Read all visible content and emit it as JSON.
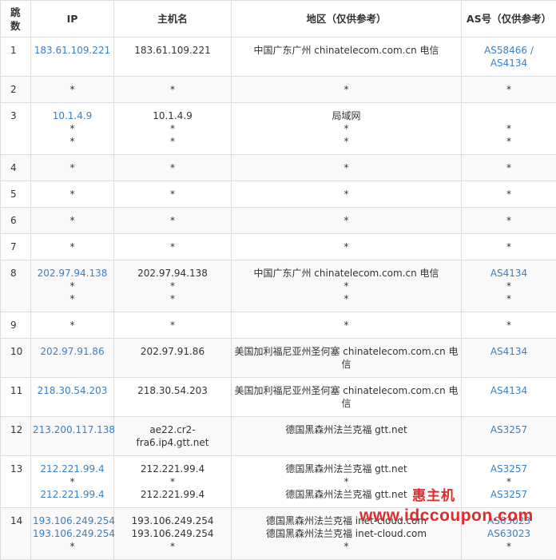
{
  "headers": {
    "hop": "跳\n数",
    "ip": "IP",
    "host": "主机名",
    "region": "地区（仅供参考）",
    "as": "AS号（仅供参考）"
  },
  "rows": [
    {
      "hop": "1",
      "ip": [
        {
          "t": "183.61.109.221",
          "link": true
        }
      ],
      "host": [
        "183.61.109.221"
      ],
      "region": [
        "中国广东广州 chinatelecom.com.cn 电信"
      ],
      "as": [
        {
          "t": "AS58466 /",
          "link": true
        },
        {
          "t": "AS4134",
          "link": true
        }
      ]
    },
    {
      "hop": "2",
      "ip": [
        {
          "t": "*",
          "link": false
        }
      ],
      "host": [
        "*"
      ],
      "region": [
        "*"
      ],
      "as": [
        {
          "t": "*",
          "link": false
        }
      ]
    },
    {
      "hop": "3",
      "ip": [
        {
          "t": "10.1.4.9",
          "link": true
        },
        {
          "t": "*",
          "link": false
        },
        {
          "t": "*",
          "link": false
        }
      ],
      "host": [
        "10.1.4.9",
        "*",
        "*"
      ],
      "region": [
        "局域网",
        "*",
        "*"
      ],
      "as": [
        {
          "t": "",
          "link": false
        },
        {
          "t": "*",
          "link": false
        },
        {
          "t": "*",
          "link": false
        }
      ]
    },
    {
      "hop": "4",
      "ip": [
        {
          "t": "*",
          "link": false
        }
      ],
      "host": [
        "*"
      ],
      "region": [
        "*"
      ],
      "as": [
        {
          "t": "*",
          "link": false
        }
      ]
    },
    {
      "hop": "5",
      "ip": [
        {
          "t": "*",
          "link": false
        }
      ],
      "host": [
        "*"
      ],
      "region": [
        "*"
      ],
      "as": [
        {
          "t": "*",
          "link": false
        }
      ]
    },
    {
      "hop": "6",
      "ip": [
        {
          "t": "*",
          "link": false
        }
      ],
      "host": [
        "*"
      ],
      "region": [
        "*"
      ],
      "as": [
        {
          "t": "*",
          "link": false
        }
      ]
    },
    {
      "hop": "7",
      "ip": [
        {
          "t": "*",
          "link": false
        }
      ],
      "host": [
        "*"
      ],
      "region": [
        "*"
      ],
      "as": [
        {
          "t": "*",
          "link": false
        }
      ]
    },
    {
      "hop": "8",
      "ip": [
        {
          "t": "202.97.94.138",
          "link": true
        },
        {
          "t": "*",
          "link": false
        },
        {
          "t": "*",
          "link": false
        }
      ],
      "host": [
        "202.97.94.138",
        "*",
        "*"
      ],
      "region": [
        "中国广东广州 chinatelecom.com.cn 电信",
        "*",
        "*"
      ],
      "as": [
        {
          "t": "AS4134",
          "link": true
        },
        {
          "t": "*",
          "link": false
        },
        {
          "t": "*",
          "link": false
        }
      ]
    },
    {
      "hop": "9",
      "ip": [
        {
          "t": "*",
          "link": false
        }
      ],
      "host": [
        "*"
      ],
      "region": [
        "*"
      ],
      "as": [
        {
          "t": "*",
          "link": false
        }
      ]
    },
    {
      "hop": "10",
      "ip": [
        {
          "t": "202.97.91.86",
          "link": true
        }
      ],
      "host": [
        "202.97.91.86"
      ],
      "region": [
        "美国加利福尼亚州圣何塞 chinatelecom.com.cn 电",
        "信"
      ],
      "as": [
        {
          "t": "AS4134",
          "link": true
        }
      ]
    },
    {
      "hop": "11",
      "ip": [
        {
          "t": "218.30.54.203",
          "link": true
        }
      ],
      "host": [
        "218.30.54.203"
      ],
      "region": [
        "美国加利福尼亚州圣何塞 chinatelecom.com.cn 电",
        "信"
      ],
      "as": [
        {
          "t": "AS4134",
          "link": true
        }
      ]
    },
    {
      "hop": "12",
      "ip": [
        {
          "t": "213.200.117.138",
          "link": true
        }
      ],
      "host": [
        "ae22.cr2-",
        "fra6.ip4.gtt.net"
      ],
      "region": [
        "德国黑森州法兰克福 gtt.net"
      ],
      "as": [
        {
          "t": "AS3257",
          "link": true
        }
      ]
    },
    {
      "hop": "13",
      "ip": [
        {
          "t": "212.221.99.4",
          "link": true
        },
        {
          "t": "*",
          "link": false
        },
        {
          "t": "212.221.99.4",
          "link": true
        }
      ],
      "host": [
        "212.221.99.4",
        "*",
        "212.221.99.4"
      ],
      "region": [
        "德国黑森州法兰克福 gtt.net",
        "*",
        "德国黑森州法兰克福 gtt.net"
      ],
      "as": [
        {
          "t": "AS3257",
          "link": true
        },
        {
          "t": "*",
          "link": false
        },
        {
          "t": "AS3257",
          "link": true
        }
      ]
    },
    {
      "hop": "14",
      "ip": [
        {
          "t": "193.106.249.254",
          "link": true
        },
        {
          "t": "193.106.249.254",
          "link": true
        },
        {
          "t": "*",
          "link": false
        }
      ],
      "host": [
        "193.106.249.254",
        "193.106.249.254",
        "*"
      ],
      "region": [
        "德国黑森州法兰克福 inet-cloud.com",
        "德国黑森州法兰克福 inet-cloud.com",
        "*"
      ],
      "as": [
        {
          "t": "AS63023",
          "link": true
        },
        {
          "t": "AS63023",
          "link": true
        },
        {
          "t": "*",
          "link": false
        }
      ]
    }
  ],
  "watermark": {
    "brand": "惠主机",
    "url": "www.idccoupon.com"
  },
  "colors": {
    "link": "#3a80c2",
    "border": "#dddddd",
    "stripe": "#f9f9f9",
    "watermark": "#e02b2b"
  }
}
